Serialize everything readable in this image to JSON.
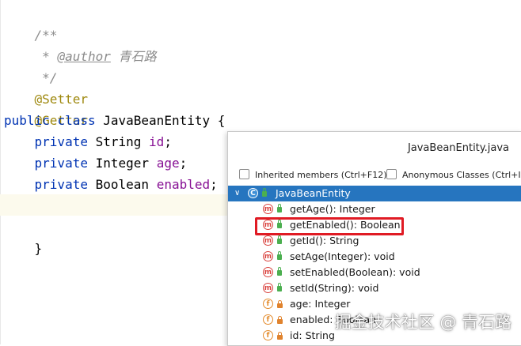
{
  "editor": {
    "comment_open": "/**",
    "comment_star": " * ",
    "author_tag": "@author",
    "author_name": " 青石路",
    "comment_close": " */",
    "annotation1": "@Setter",
    "annotation2": "@Getter",
    "kw_public": "public",
    "kw_class": "class",
    "class_name": "JavaBeanEntity",
    "brace_open": "{",
    "kw_private": "private",
    "field1_type": "String",
    "field1_name": "id",
    "field2_type": "Integer",
    "field2_name": "age",
    "field3_type": "Boolean",
    "field3_name": "enabled",
    "semicolon": ";",
    "brace_close": "}"
  },
  "popup": {
    "title": "JavaBeanEntity.java",
    "option_inherited": "Inherited members (Ctrl+F12)",
    "option_anonymous": "Anonymous Classes (Ctrl+I)",
    "root": {
      "label": "JavaBeanEntity",
      "icon": "class-icon",
      "chevron": "∨"
    },
    "members": [
      {
        "label": "getAge(): Integer",
        "kind": "m",
        "visibility": "public"
      },
      {
        "label": "getEnabled(): Boolean",
        "kind": "m",
        "visibility": "public"
      },
      {
        "label": "getId(): String",
        "kind": "m",
        "visibility": "public"
      },
      {
        "label": "setAge(Integer): void",
        "kind": "m",
        "visibility": "public"
      },
      {
        "label": "setEnabled(Boolean): void",
        "kind": "m",
        "visibility": "public"
      },
      {
        "label": "setId(String): void",
        "kind": "m",
        "visibility": "public"
      },
      {
        "label": "age: Integer",
        "kind": "f",
        "visibility": "private"
      },
      {
        "label": "enabled: Boolean",
        "kind": "f",
        "visibility": "private"
      },
      {
        "label": "id: String",
        "kind": "f",
        "visibility": "private"
      }
    ]
  },
  "watermark": "掘金技术社区 @ 青石路",
  "colors": {
    "selection": "#2675bf",
    "highlight_box": "#e01b24",
    "keyword": "#0033b3",
    "field": "#871094",
    "annotation": "#9e880d"
  }
}
